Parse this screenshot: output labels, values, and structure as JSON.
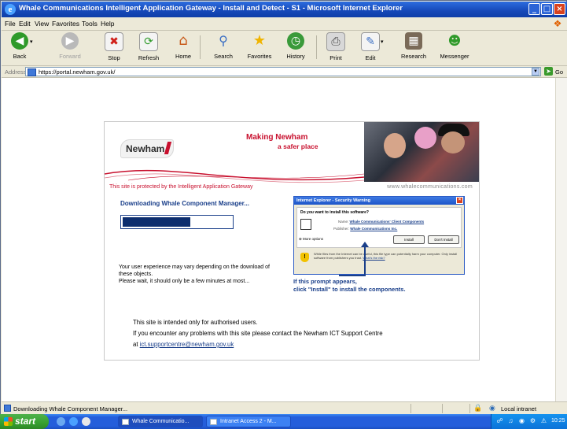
{
  "window": {
    "title": "Whale Communications Intelligent Application Gateway - Install and Detect - S1 - Microsoft Internet Explorer"
  },
  "menu": [
    "File",
    "Edit",
    "View",
    "Favorites",
    "Tools",
    "Help"
  ],
  "toolbar": {
    "back": "Back",
    "forward": "Forward",
    "stop": "Stop",
    "refresh": "Refresh",
    "home": "Home",
    "search": "Search",
    "favorites": "Favorites",
    "history": "History",
    "print": "Print",
    "edit": "Edit",
    "research": "Research",
    "messenger": "Messenger"
  },
  "address": {
    "label": "Address",
    "url": "https://portal.newham.gov.uk/",
    "go": "Go"
  },
  "page": {
    "logo": "Newham",
    "slogan_line1": "Making Newham",
    "slogan_line2": "a safer place",
    "protected_text": "This site is protected by the Intelligent Application Gateway",
    "website": "www.whalecommunications.com",
    "downloading": "Downloading Whale Component Manager...",
    "progress_fraction": 0.62,
    "message_line1": "Your user experience may vary depending on the download of",
    "message_line2": "these objects.",
    "message_line3": "Please wait, it should only be a few minutes at most...",
    "prompt_line1": "If this prompt appears,",
    "prompt_line2": "click \"Install\" to install the components.",
    "notice_line1": "This site is intended only for authorised users.",
    "notice_line2": "If you encounter any problems with this site please contact the Newham ICT Support Centre",
    "notice_prefix": "at ",
    "notice_email": "ict.supportcentre@newham.gov.uk"
  },
  "dialog": {
    "title": "Internet Explorer - Security Warning",
    "question": "Do you want to install this software?",
    "name_label": "Name:",
    "name_value": "Whale Communications' Client Components",
    "publisher_label": "Publisher:",
    "publisher_value": "Whale Communications Inc.",
    "more_options": "More options",
    "install": "Install",
    "dont_install": "Don't Install",
    "warning": "While files from the Internet can be useful, this file type can potentially harm your computer. Only install software from publishers you trust.",
    "warning_link": "What's the risk?"
  },
  "status": {
    "text": "Downloading Whale Component Manager...",
    "zone": "Local intranet"
  },
  "taskbar": {
    "start": "start",
    "tasks": [
      "Whale Communicatio...",
      "Intranet Access 2 - M..."
    ],
    "clock": "10:25"
  },
  "colors": {
    "newham_red": "#c8102e",
    "text_blue": "#1a3f8a",
    "xp_blue": "#245edb"
  }
}
